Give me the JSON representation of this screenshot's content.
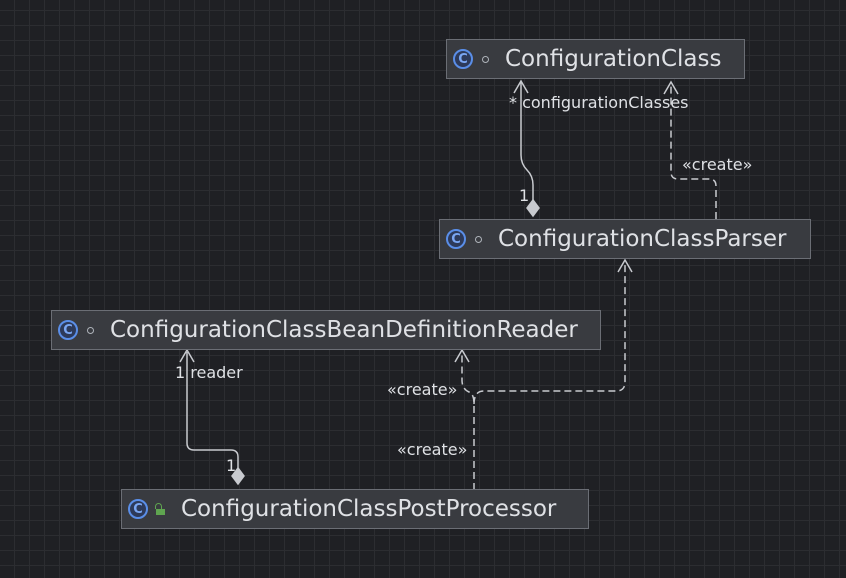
{
  "nodes": {
    "configuration_class": {
      "name": "ConfigurationClass",
      "kind_icon": "class-icon",
      "visibility_icon": "package-private-icon"
    },
    "configuration_class_parser": {
      "name": "ConfigurationClassParser",
      "kind_icon": "class-icon",
      "visibility_icon": "package-private-icon"
    },
    "bean_definition_reader": {
      "name": "ConfigurationClassBeanDefinitionReader",
      "kind_icon": "class-icon",
      "visibility_icon": "package-private-icon"
    },
    "post_processor": {
      "name": "ConfigurationClassPostProcessor",
      "kind_icon": "class-icon",
      "visibility_icon": "public-icon"
    }
  },
  "edges": {
    "parser_to_class_composition": {
      "source_multiplicity": "1",
      "target_label": "* configurationClasses"
    },
    "parser_creates_class": {
      "label": "«create»"
    },
    "processor_to_reader_composition": {
      "source_multiplicity": "1",
      "target_label": "1 reader"
    },
    "processor_creates_reader": {
      "label": "«create»"
    },
    "processor_creates_parser": {
      "label": "«create»"
    }
  },
  "colors": {
    "background": "#1f2024",
    "node_fill": "#393b40",
    "node_border": "#6b6e75",
    "edge": "#c8cacf",
    "text": "#dfe1e5",
    "class_icon": "#5a8ee8",
    "public_icon": "#5fa550"
  }
}
